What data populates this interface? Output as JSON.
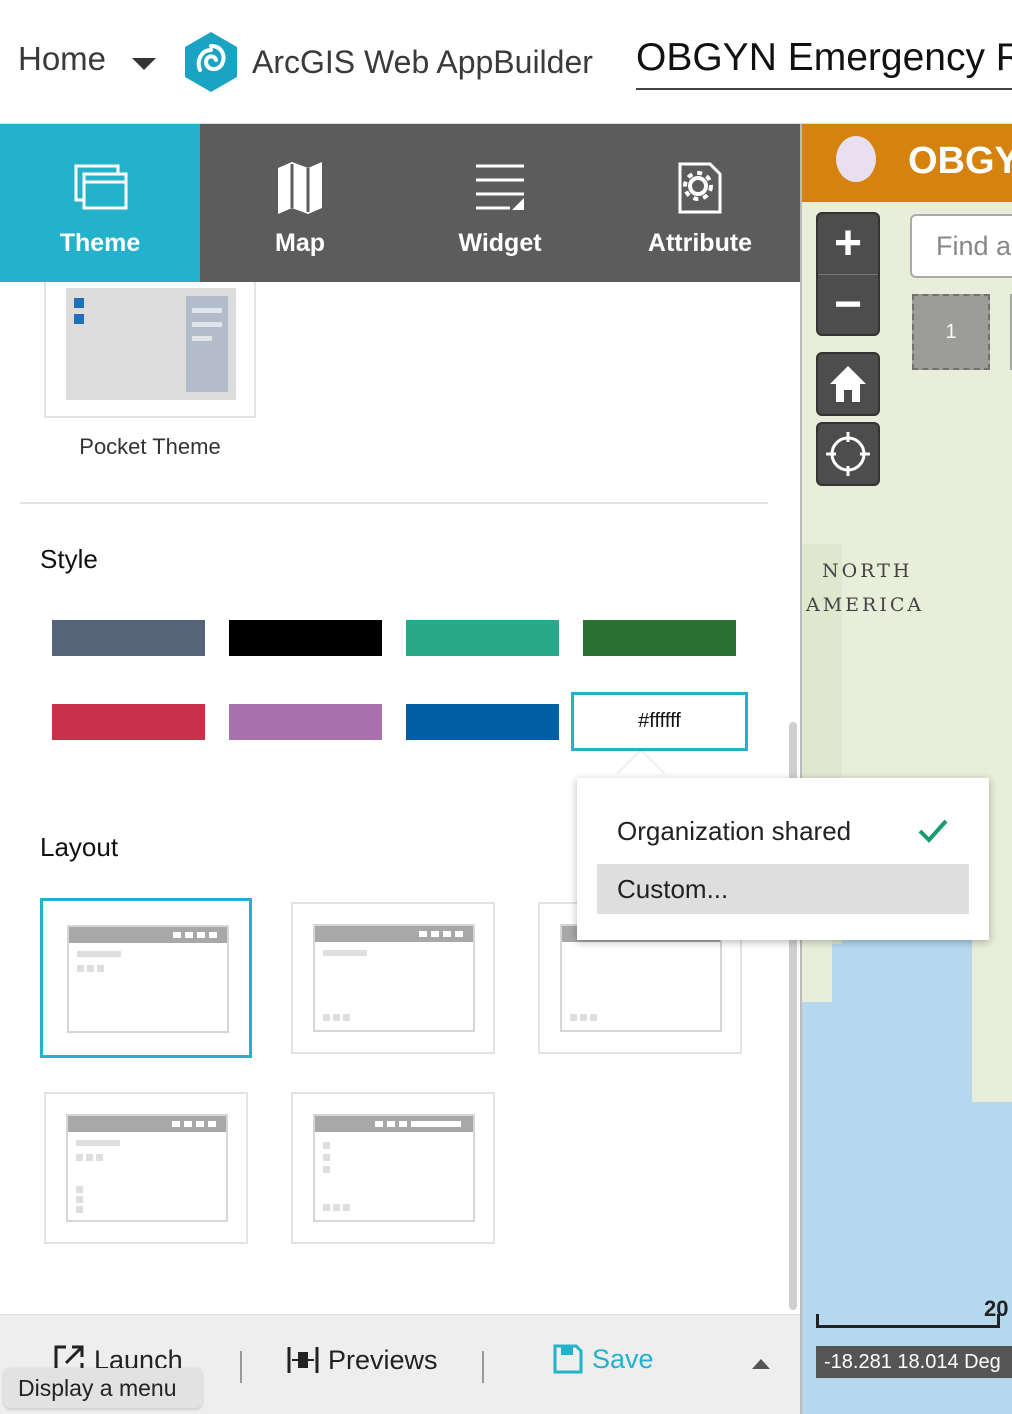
{
  "header": {
    "home_label": "Home",
    "app_name": "ArcGIS Web AppBuilder",
    "app_title": "OBGYN Emergency R"
  },
  "tabs": [
    {
      "label": "Theme",
      "icon": "theme-icon",
      "active": true
    },
    {
      "label": "Map",
      "icon": "map-icon",
      "active": false
    },
    {
      "label": "Widget",
      "icon": "widget-icon",
      "active": false
    },
    {
      "label": "Attribute",
      "icon": "attribute-icon",
      "active": false
    }
  ],
  "themes": {
    "pocket_label": "Pocket Theme"
  },
  "style": {
    "title": "Style",
    "swatches": [
      "#566479",
      "#000000",
      "#2aa98a",
      "#2a7033",
      "#c8314a",
      "#a871ae",
      "#005ea4"
    ],
    "custom_value": "#ffffff"
  },
  "color_menu": {
    "items": [
      {
        "label": "Organization shared",
        "checked": true
      },
      {
        "label": "Custom...",
        "checked": false
      }
    ]
  },
  "layout": {
    "title": "Layout"
  },
  "footer": {
    "launch_label": "Launch",
    "previews_label": "Previews",
    "save_label": "Save",
    "tooltip": "Display a menu"
  },
  "map_preview": {
    "title": "OBGY",
    "search_placeholder": "Find a",
    "cluster_count": "1",
    "label_north": "NORTH",
    "label_america": "AMERICA",
    "scale_label": "20",
    "coordinates": "-18.281 18.014 Deg"
  },
  "colors": {
    "accent": "#23b1cc",
    "tabbar": "#5c5c5c",
    "map_header": "#d6820e",
    "check": "#1a9b6e"
  }
}
